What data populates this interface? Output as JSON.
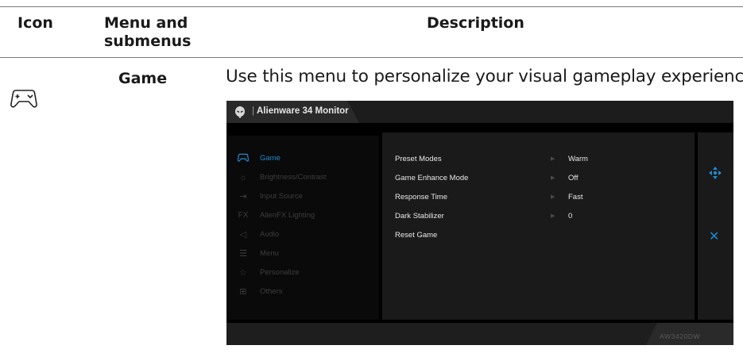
{
  "table": {
    "headers": {
      "icon": "Icon",
      "menu_line1": "Menu and",
      "menu_line2": "submenus",
      "description": "Description"
    },
    "row": {
      "icon": "gamepad-icon",
      "menu": "Game",
      "description": "Use this menu to personalize your visual gameplay experience."
    }
  },
  "osd": {
    "title": "Alienware 34 Monitor",
    "model": "AW3420DW",
    "accent_color": "#1e8bd0",
    "nav": [
      {
        "label": "Game",
        "icon": "gamepad-icon",
        "glyph": "⌘",
        "active": true
      },
      {
        "label": "Brightness/Contrast",
        "icon": "sun-icon",
        "glyph": "☼",
        "active": false
      },
      {
        "label": "Input Source",
        "icon": "input-icon",
        "glyph": "⇥",
        "active": false
      },
      {
        "label": "AlienFX Lighting",
        "icon": "fx-icon",
        "glyph": "FX",
        "active": false
      },
      {
        "label": "Audio",
        "icon": "speaker-icon",
        "glyph": "◁",
        "active": false
      },
      {
        "label": "Menu",
        "icon": "menu-icon",
        "glyph": "☰",
        "active": false
      },
      {
        "label": "Personalize",
        "icon": "star-icon",
        "glyph": "☆",
        "active": false
      },
      {
        "label": "Others",
        "icon": "others-icon",
        "glyph": "⊞",
        "active": false
      }
    ],
    "settings": [
      {
        "label": "Preset Modes",
        "value": "Warm"
      },
      {
        "label": "Game Enhance Mode",
        "value": "Off"
      },
      {
        "label": "Response Time",
        "value": "Fast"
      },
      {
        "label": "Dark Stabilizer",
        "value": "0"
      },
      {
        "label": "Reset Game",
        "value": ""
      }
    ],
    "side_icons": [
      "move-icon",
      "close-icon"
    ]
  }
}
